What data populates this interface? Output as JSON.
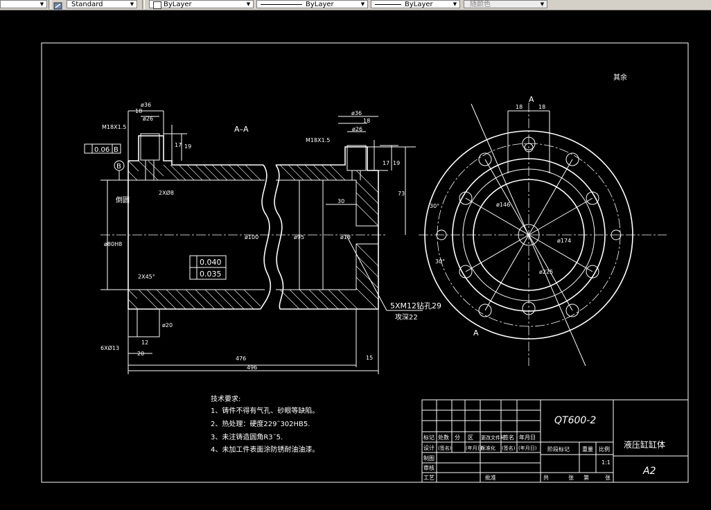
{
  "toolbar": {
    "textstyle": "Standard",
    "layer": "ByLayer",
    "linetype": "ByLayer",
    "lineweight": "ByLayer",
    "color": "随颜色"
  },
  "drawing": {
    "section_label": "A–A",
    "view_label_top": "A",
    "view_label_bottom": "A",
    "roughness_note": "其余",
    "dims": {
      "d36_left": "ø36",
      "d26_left": "ø26",
      "n18_left": "18",
      "m18_left": "M18X1.5",
      "d36_right": "ø36",
      "d26_right": "ø26",
      "n18_right": "18",
      "m18_right": "M18X1.5",
      "n17": "17",
      "n19": "19",
      "n17b": "17",
      "n19b": "19",
      "n73": "73",
      "n30": "30",
      "hole": "2XØ8",
      "chamfer_side": "倒圆",
      "bore": "ø80H8",
      "chamfer": "2X45°",
      "d100": "ø100",
      "d95": "ø95",
      "d18": "ø18",
      "flatness": "0.06",
      "datum": "B",
      "tol1": "0.040",
      "tol2": "0.035",
      "n476": "476",
      "n496": "496",
      "n15": "15",
      "n20": "20",
      "n12": "12",
      "d20": "ø20",
      "holes6": "6XØ13",
      "thread_note": "5XM12钻孔29",
      "thread_note2": "攻深22",
      "d146": "ø146",
      "d174": "ø174",
      "d225": "ø225",
      "ang30": "30°",
      "ang30b": "30°",
      "n18a": "18",
      "n18b": "18"
    },
    "tech": {
      "title": "技术要求:",
      "items": [
        "1、铸件不得有气孔、砂眼等缺陷。",
        "2、热处理：硬度229˜302HB5.",
        "3、未注铸造圆角R3˜5.",
        "4、未加工件表面涂防锈耐油油漆。"
      ]
    },
    "title_block": {
      "material": "QT600-2",
      "part_name": "液压缸缸体",
      "sheet_size": "A2",
      "scale": "1:1",
      "row_headers": [
        "标记",
        "处数",
        "分",
        "区",
        "更改文件号",
        "签名",
        "年月日"
      ],
      "design_row": [
        "设计",
        "(签名)",
        "(年月日)",
        "标准化",
        "(签名)",
        "(年月日)"
      ],
      "draw": "制图",
      "check": "审核",
      "process": "工艺",
      "approve": "批准",
      "stage_mark": "阶段标记",
      "weight": "重量",
      "ratio": "比例",
      "total": "共",
      "sheet": "张",
      "page": "第",
      "page_unit": "张"
    }
  }
}
